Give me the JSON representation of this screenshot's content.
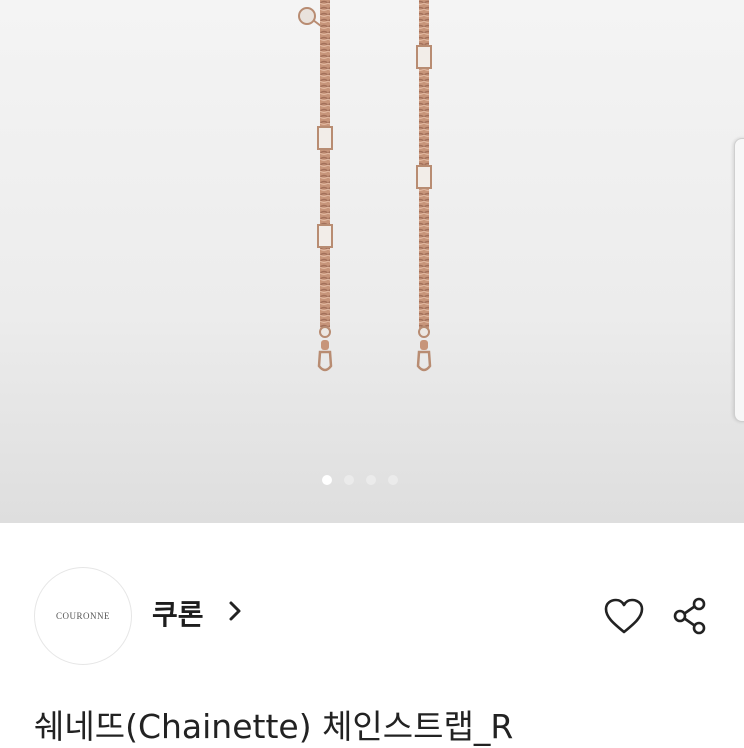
{
  "hero": {
    "image_alt": "Chainette chain strap product photo",
    "carousel": {
      "total": 4,
      "active_index": 0
    }
  },
  "brand": {
    "logo_text": "COURONNE",
    "name": "쿠론",
    "chevron": "chevron-right-icon"
  },
  "actions": {
    "like_icon": "heart-icon",
    "share_icon": "share-icon"
  },
  "product": {
    "title": "쉐네뜨(Chainette) 체인스트랩_R"
  },
  "colors": {
    "chain": "#c99a7a",
    "text": "#222222"
  }
}
